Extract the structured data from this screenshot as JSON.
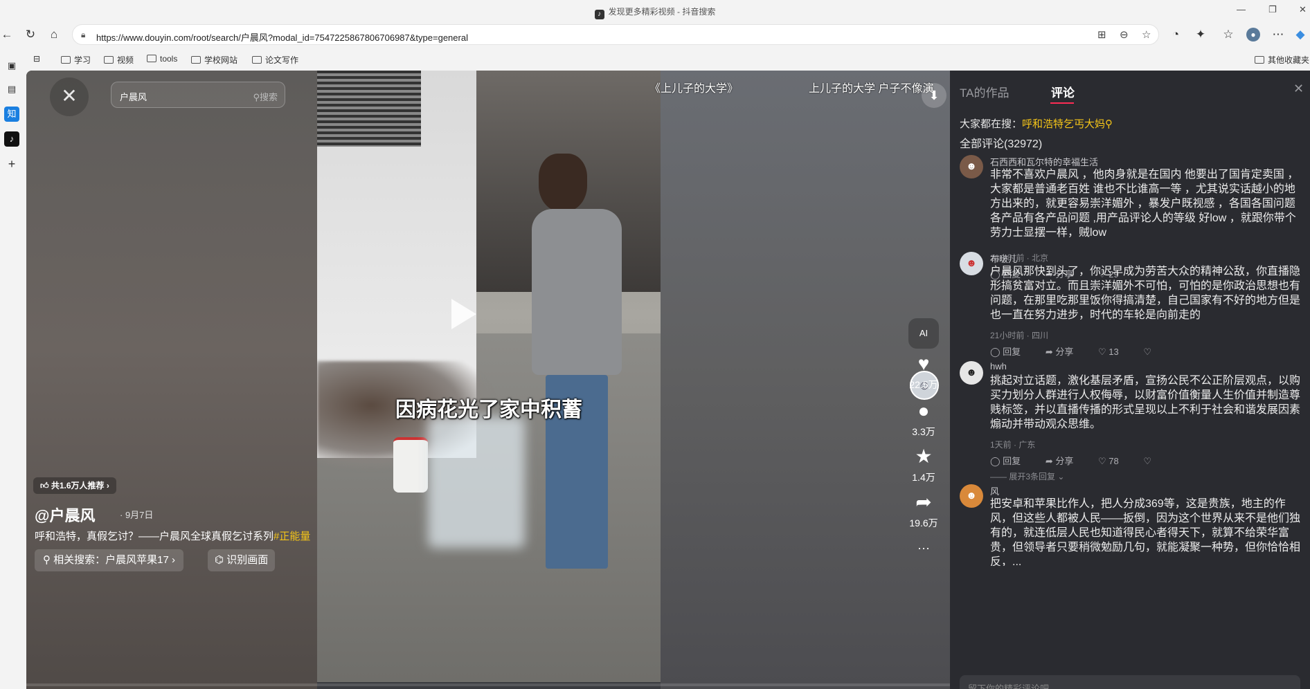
{
  "window": {
    "title": "发现更多精彩视频 - 抖音搜索",
    "minimize": "—",
    "maximize": "❐",
    "close": "✕"
  },
  "nav": {
    "url": "https://www.douyin.com/root/search/户晨风?modal_id=7547225867806706987&type=general",
    "icons": [
      "back-icon",
      "refresh-icon",
      "home-icon",
      "lock-icon",
      "app-icon",
      "zoom-icon",
      "favorite-icon",
      "extension-icon",
      "puzzle-icon",
      "collections-icon",
      "profile-icon",
      "more-icon"
    ]
  },
  "bookmarks": {
    "items": [
      "学习",
      "视频",
      "tools",
      "学校网站",
      "论文写作"
    ],
    "other": "其他收藏夹"
  },
  "player": {
    "search_query": "户晨风",
    "search_button": "搜索",
    "subtitle": "因病花光了家中积蓄",
    "top_caption_left": "《上儿子的大学》",
    "top_caption_right": "上儿子的大学 户子不像演",
    "recommend_badge": "共1.6万人推荐",
    "author": "@户晨风",
    "date": "· 9月7日",
    "description": "呼和浩特，真假乞讨？——户晨风全球真假乞讨系列",
    "hashtag": "#正能量",
    "related_search": "相关搜索：户晨风苹果17",
    "identify": "识别画面",
    "ai_label": "AI",
    "likes": "22.5万",
    "comments": "3.3万",
    "favorites": "1.4万",
    "shares": "19.6万",
    "more": "···",
    "progress": 0.0
  },
  "panel": {
    "tabs": [
      "TA的作品",
      "评论"
    ],
    "active_tab": 1,
    "trending_label": "大家都在搜：",
    "trending_term": "呼和浩特乞丐大妈",
    "total_comments": "全部评论(32972)",
    "input_placeholder": "留下你的精彩评论吧",
    "comments": [
      {
        "user": "石西西和瓦尔特的幸福生活",
        "avatar_color": "#7a5a48",
        "text": "非常不喜欢户晨风 ，他肉身就是在国内 他要出了国肯定卖国 ，  大家都是普通老百姓  谁也不比谁高一等 ，尤其说实话越小的地方出来的，就更容易崇洋媚外  ，暴发户既视感  ，各国各国问题 各产品有各产品问题 ,用产品评论人的等级  好low ，就跟你带个劳力士显摆一样，贼low",
        "meta": "23小时前 · 北京",
        "reply": "回复",
        "share": "分享",
        "likes": "29"
      },
      {
        "user": "布啵儿",
        "avatar_color": "#d8dde3",
        "text": "户晨风那快到头了，你迟早成为劳苦大众的精神公敌，你直播隐形搞贫富对立。而且崇洋媚外不可怕，可怕的是你政治思想也有问题，在那里吃那里饭你得搞清楚，自己国家有不好的地方但是也一直在努力进步，时代的车轮是向前走的",
        "meta": "21小时前 · 四川",
        "reply": "回复",
        "share": "分享",
        "likes": "13"
      },
      {
        "user": "hwh",
        "avatar_color": "#e6e6e6",
        "text": "挑起对立话题，激化基层矛盾，宣扬公民不公正阶层观点，以购买力划分人群进行人权侮辱，以财富价值衡量人生价值并制造尊贱标签，并以直播传播的形式呈现以上不利于社会和谐发展因素煽动并带动观众思维。",
        "meta": "1天前 · 广东",
        "reply": "回复",
        "share": "分享",
        "likes": "78",
        "expand": "展开3条回复"
      },
      {
        "user": "风",
        "avatar_color": "#d9893a",
        "text": "把安卓和苹果比作人，把人分成369等，这是贵族，地主的作风，但这些人都被人民——扳倒，因为这个世界从来不是他们独有的，就连低层人民也知道得民心者得天下，就算不给荣华富贵，但领导者只要稍微勉励几句，就能凝聚一种势，但你恰恰相反，..."
      }
    ]
  }
}
